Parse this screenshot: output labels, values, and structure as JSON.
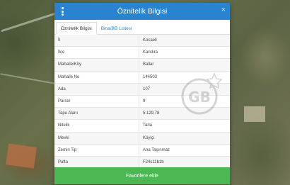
{
  "dialog": {
    "title": "Öznitelik Bilgisi",
    "close_glyph": "×"
  },
  "tabs": [
    {
      "label": "Öznitelik Bilgisi",
      "active": true
    },
    {
      "label": "Bina/BB Listesi",
      "active": false
    }
  ],
  "rows": [
    {
      "key": "İl",
      "value": "Kocaeli"
    },
    {
      "key": "İlçe",
      "value": "Kandıra"
    },
    {
      "key": "Mahalle/Köy",
      "value": "Ballar"
    },
    {
      "key": "Mahalle No",
      "value": "144503"
    },
    {
      "key": "Ada",
      "value": "107"
    },
    {
      "key": "Parsel",
      "value": "9"
    },
    {
      "key": "Tapu Alanı",
      "value": "5.129,78"
    },
    {
      "key": "Nitelik",
      "value": "Tarla"
    },
    {
      "key": "Mevki",
      "value": "Köyiçi"
    },
    {
      "key": "Zemin Tip",
      "value": "Ana Taşınmaz"
    },
    {
      "key": "Pafta",
      "value": "F24c11b1b"
    }
  ],
  "footer": {
    "favorite_label": "Favorilere ekle"
  },
  "watermark": {
    "text": "GB"
  },
  "colors": {
    "header": "#2a83cf",
    "footer_button": "#4cb853"
  }
}
